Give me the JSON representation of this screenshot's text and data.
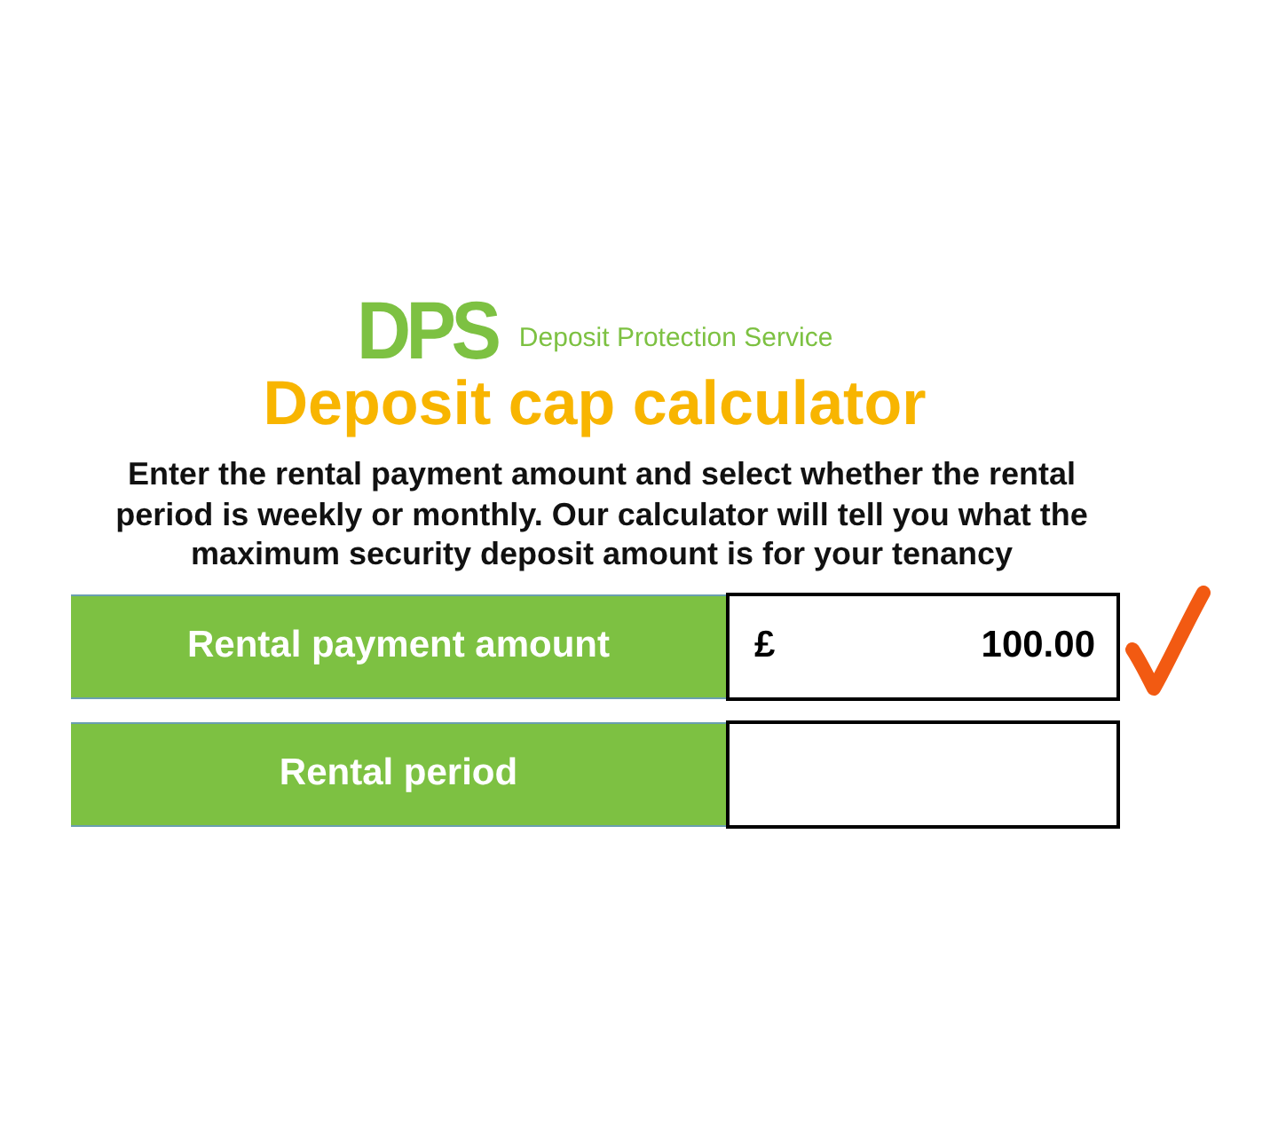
{
  "logo": {
    "mark": "DPS",
    "name": "Deposit Protection Service"
  },
  "title": "Deposit cap calculator",
  "intro": "Enter the rental payment amount and select whether the rental period is weekly or monthly. Our calculator will tell you what the maximum security deposit amount is for your tenancy",
  "fields": [
    {
      "label": "Rental payment amount",
      "currency": "£",
      "value": "100.00",
      "checked": true
    },
    {
      "label": "Rental period",
      "checked": false
    }
  ]
}
